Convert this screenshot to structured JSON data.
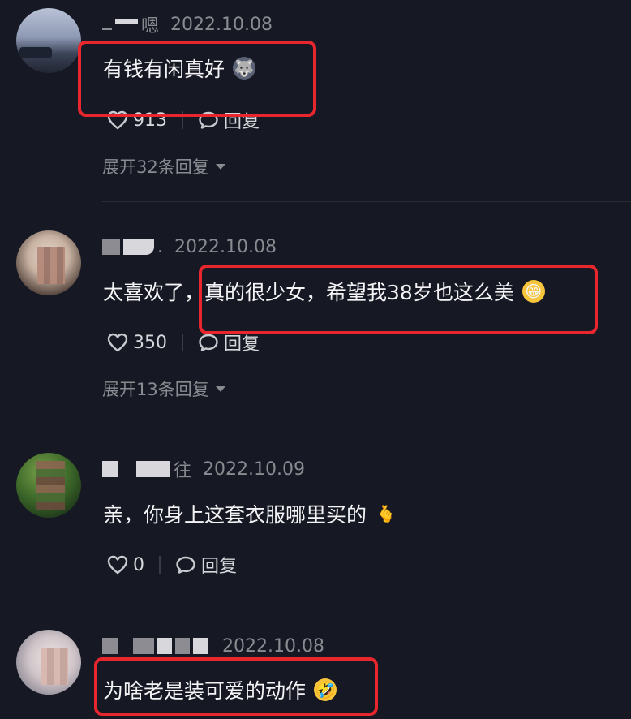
{
  "comments": [
    {
      "username": "嗯",
      "date": "2022.10.08",
      "text": "有钱有闲真好",
      "emoji": "🐺",
      "likes": "913",
      "reply_label": "回复",
      "expand": "展开32条回复"
    },
    {
      "username": ".",
      "date": "2022.10.08",
      "text": "太喜欢了，真的很少女，希望我38岁也这么美",
      "emoji": "😁",
      "likes": "350",
      "reply_label": "回复",
      "expand": "展开13条回复"
    },
    {
      "username": "往",
      "date": "2022.10.09",
      "text": "亲，你身上这套衣服哪里买的",
      "emoji": "🫰",
      "likes": "0",
      "reply_label": "回复"
    },
    {
      "username": "",
      "date": "2022.10.08",
      "text": "为啥老是装可爱的动作",
      "emoji": "🤣"
    }
  ],
  "colors": {
    "background": "#161823",
    "highlight_border": "#e8262d",
    "muted_text": "#8a8b91"
  }
}
